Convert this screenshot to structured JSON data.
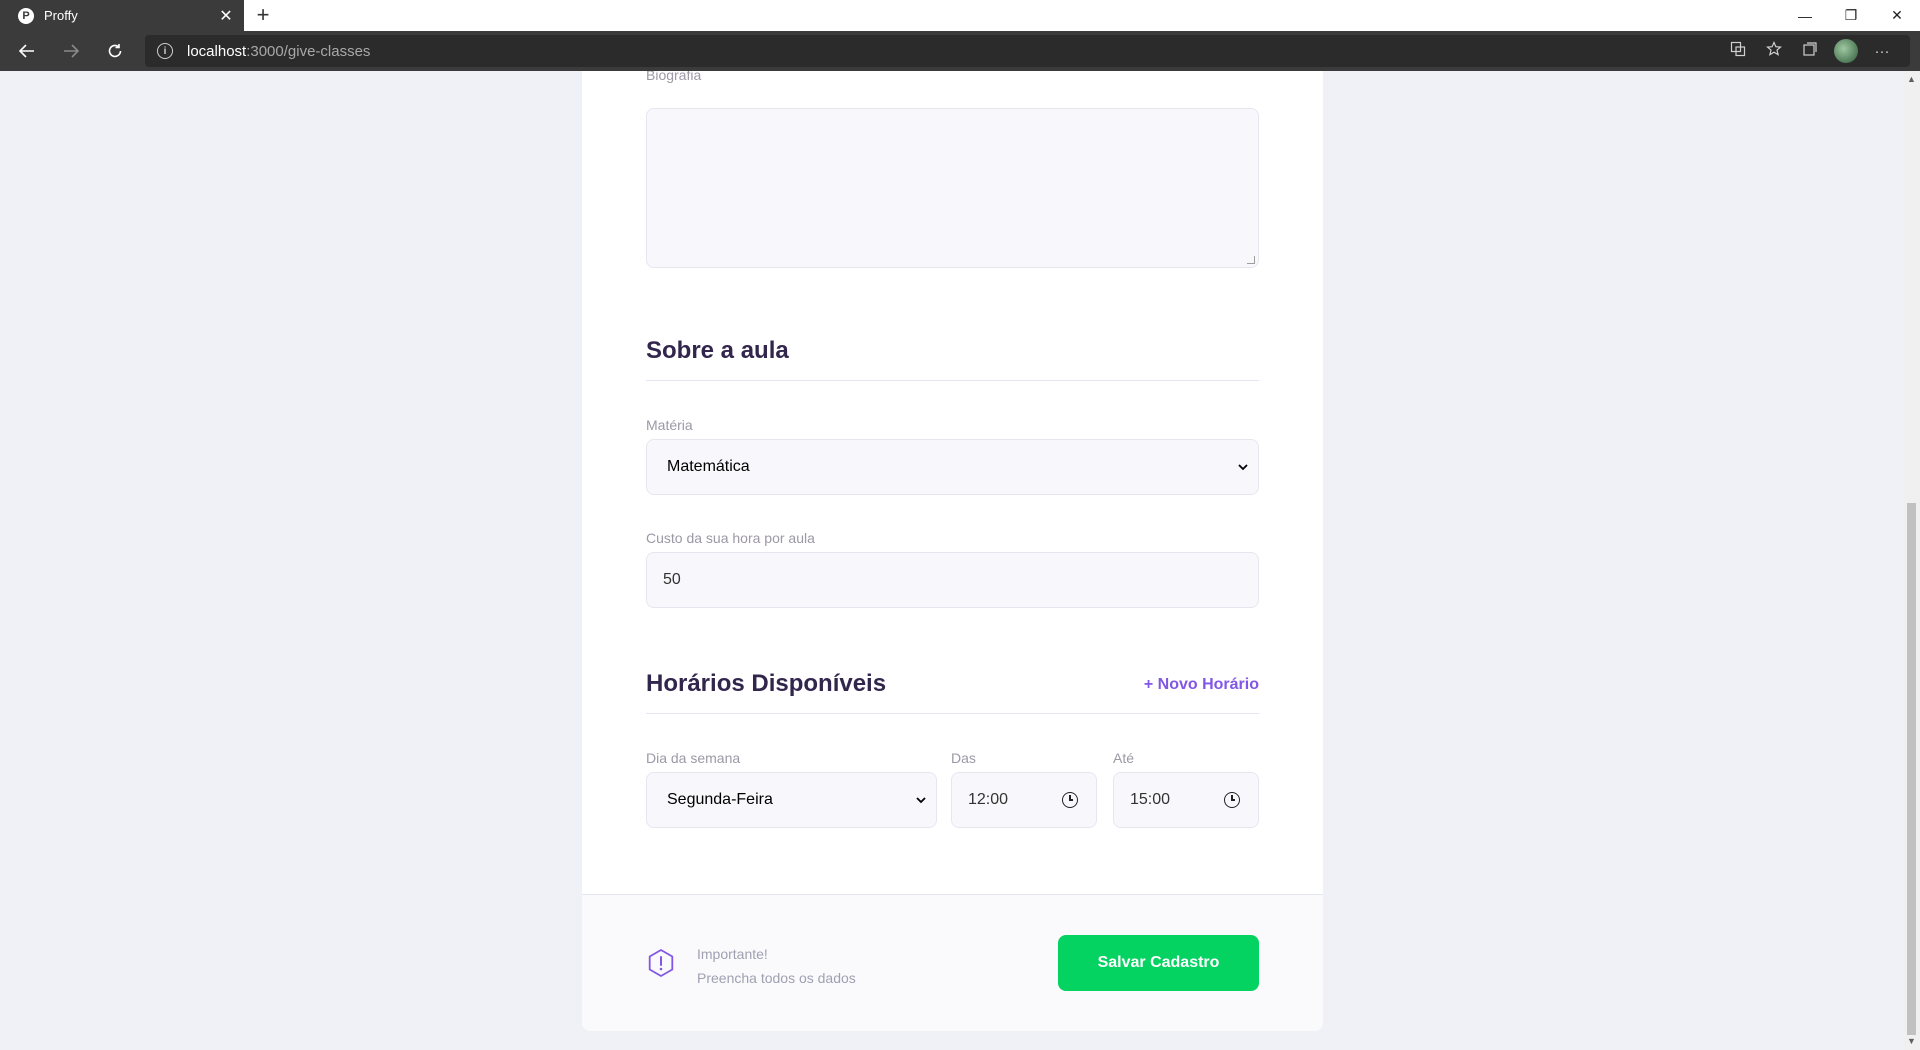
{
  "browser": {
    "tab_title": "Proffy",
    "favicon_letter": "P",
    "new_tab_symbol": "+",
    "close_symbol": "✕",
    "url_host": "localhost",
    "url_path": ":3000/give-classes",
    "window_controls": {
      "minimize": "—",
      "restore": "❐",
      "close": "✕"
    }
  },
  "form": {
    "bio": {
      "label": "Biografia",
      "value": ""
    },
    "about_class": {
      "title": "Sobre a aula",
      "subject_label": "Matéria",
      "subject_value": "Matemática",
      "cost_label": "Custo da sua hora por aula",
      "cost_value": "50"
    },
    "schedule": {
      "title": "Horários Disponíveis",
      "add_label": "+ Novo Horário",
      "weekday_label": "Dia da semana",
      "weekday_value": "Segunda-Feira",
      "from_label": "Das",
      "from_value": "12:00",
      "to_label": "Até",
      "to_value": "15:00"
    },
    "footer": {
      "warning_title": "Importante!",
      "warning_text": "Preencha todos os dados",
      "save_label": "Salvar Cadastro"
    }
  },
  "colors": {
    "primary": "#8257e5",
    "secondary": "#04d361",
    "title": "#32264d",
    "page_bg": "#f0f0f7"
  },
  "icons": [
    "back-arrow-icon",
    "forward-arrow-icon",
    "reload-icon",
    "info-icon",
    "translate-icon",
    "star-icon",
    "collections-icon",
    "more-icon",
    "clock-icon",
    "warning-icon",
    "chevron-down-icon"
  ]
}
